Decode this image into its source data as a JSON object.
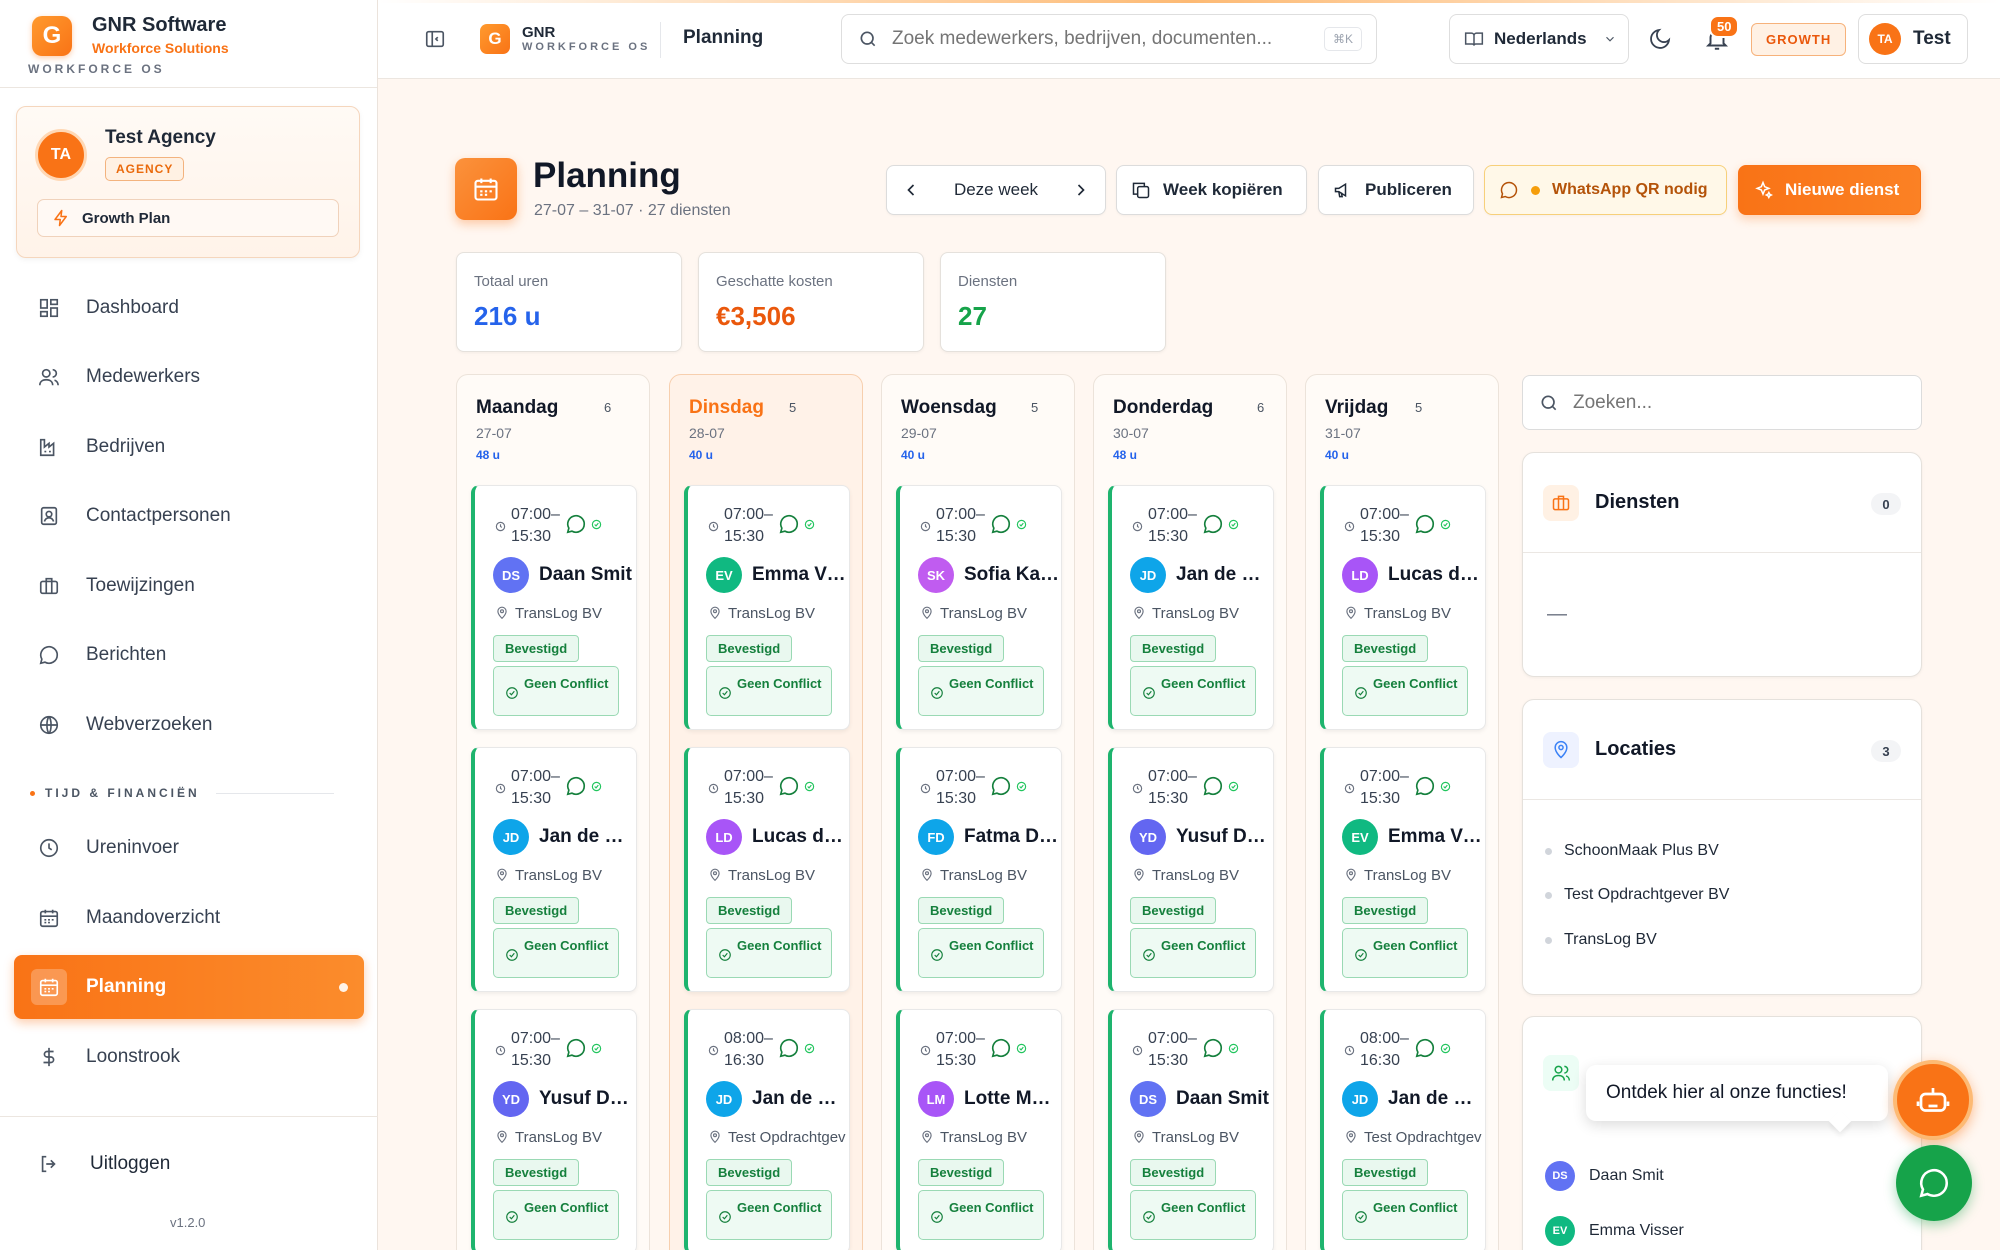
{
  "brand": {
    "name": "GNR Software",
    "subtitle": "Workforce Solutions",
    "os": "WORKFORCE OS",
    "logo_letter": "G"
  },
  "agency": {
    "initials": "TA",
    "name": "Test Agency",
    "badge": "AGENCY",
    "plan": "Growth Plan"
  },
  "nav": {
    "items": [
      {
        "label": "Dashboard",
        "icon": "dashboard-icon"
      },
      {
        "label": "Medewerkers",
        "icon": "users-icon"
      },
      {
        "label": "Bedrijven",
        "icon": "factory-icon"
      },
      {
        "label": "Contactpersonen",
        "icon": "contact-icon"
      },
      {
        "label": "Toewijzingen",
        "icon": "briefcase-icon"
      },
      {
        "label": "Berichten",
        "icon": "message-icon"
      },
      {
        "label": "Webverzoeken",
        "icon": "globe-icon"
      }
    ],
    "section_label": "TIJD & FINANCIËN",
    "section_items": [
      {
        "label": "Ureninvoer",
        "icon": "clock-icon"
      },
      {
        "label": "Maandoverzicht",
        "icon": "calendar-icon"
      },
      {
        "label": "Planning",
        "icon": "calendar-icon",
        "active": true
      },
      {
        "label": "Loonstrook",
        "icon": "dollar-icon"
      }
    ],
    "logout": "Uitloggen",
    "version": "v1.2.0"
  },
  "topbar": {
    "logo_letter": "G",
    "gnr": "GNR",
    "workforce": "WORKFORCE OS",
    "title": "Planning",
    "search_placeholder": "Zoek medewerkers, bedrijven, documenten...",
    "shortcut": "⌘K",
    "language": "Nederlands",
    "notifications": "50",
    "plan_badge": "GROWTH",
    "user_initials": "TA",
    "user_name": "Test"
  },
  "page": {
    "title": "Planning",
    "subtitle": "27-07 – 31-07 · 27 diensten",
    "week_label": "Deze week",
    "copy_label": "Week kopiëren",
    "publish_label": "Publiceren",
    "whatsapp_label": "WhatsApp QR nodig",
    "new_label": "Nieuwe dienst"
  },
  "stats": [
    {
      "label": "Totaal uren",
      "value": "216 u",
      "color": "#2563eb"
    },
    {
      "label": "Geschatte kosten",
      "value": "€3,506",
      "color": "#ea580c"
    },
    {
      "label": "Diensten",
      "value": "27",
      "color": "#16a34a"
    }
  ],
  "days": [
    {
      "name": "Maandag",
      "count": "6",
      "date": "27-07",
      "hours": "48 u",
      "today": false,
      "shifts": [
        {
          "time": "07:00–\n15:30",
          "initials": "DS",
          "name": "Daan Smit",
          "color": "#6172f3",
          "location": "TransLog BV",
          "status": "Bevestigd",
          "conflict": "Geen Conflict"
        },
        {
          "time": "07:00–\n15:30",
          "initials": "JD",
          "name": "Jan de Vries",
          "color": "#0ea5e9",
          "location": "TransLog BV",
          "status": "Bevestigd",
          "conflict": "Geen Conflict"
        },
        {
          "time": "07:00–\n15:30",
          "initials": "YD",
          "name": "Yusuf Demir",
          "color": "#6366f1",
          "location": "TransLog BV",
          "status": "Bevestigd",
          "conflict": "Geen Conflict"
        }
      ]
    },
    {
      "name": "Dinsdag",
      "count": "5",
      "date": "28-07",
      "hours": "40 u",
      "today": true,
      "shifts": [
        {
          "time": "07:00–\n15:30",
          "initials": "EV",
          "name": "Emma Visser",
          "color": "#10b981",
          "location": "TransLog BV",
          "status": "Bevestigd",
          "conflict": "Geen Conflict"
        },
        {
          "time": "07:00–\n15:30",
          "initials": "LD",
          "name": "Lucas de Boer",
          "color": "#a855f7",
          "location": "TransLog BV",
          "status": "Bevestigd",
          "conflict": "Geen Conflict"
        },
        {
          "time": "08:00–\n16:30",
          "initials": "JD",
          "name": "Jan de Vries",
          "color": "#0ea5e9",
          "location": "Test Opdrachtgever BV",
          "status": "Bevestigd",
          "conflict": "Geen Conflict"
        }
      ]
    },
    {
      "name": "Woensdag",
      "count": "5",
      "date": "29-07",
      "hours": "40 u",
      "today": false,
      "shifts": [
        {
          "time": "07:00–\n15:30",
          "initials": "SK",
          "name": "Sofia Kaya",
          "color": "#c05cf0",
          "location": "TransLog BV",
          "status": "Bevestigd",
          "conflict": "Geen Conflict"
        },
        {
          "time": "07:00–\n15:30",
          "initials": "FD",
          "name": "Fatma Demir",
          "color": "#0ea5e9",
          "location": "TransLog BV",
          "status": "Bevestigd",
          "conflict": "Geen Conflict"
        },
        {
          "time": "07:00–\n15:30",
          "initials": "LM",
          "name": "Lotte Mulder",
          "color": "#a855f7",
          "location": "TransLog BV",
          "status": "Bevestigd",
          "conflict": "Geen Conflict"
        }
      ]
    },
    {
      "name": "Donderdag",
      "count": "6",
      "date": "30-07",
      "hours": "48 u",
      "today": false,
      "shifts": [
        {
          "time": "07:00–\n15:30",
          "initials": "JD",
          "name": "Jan de Vries",
          "color": "#0ea5e9",
          "location": "TransLog BV",
          "status": "Bevestigd",
          "conflict": "Geen Conflict"
        },
        {
          "time": "07:00–\n15:30",
          "initials": "YD",
          "name": "Yusuf Demir",
          "color": "#6366f1",
          "location": "TransLog BV",
          "status": "Bevestigd",
          "conflict": "Geen Conflict"
        },
        {
          "time": "07:00–\n15:30",
          "initials": "DS",
          "name": "Daan Smit",
          "color": "#6172f3",
          "location": "TransLog BV",
          "status": "Bevestigd",
          "conflict": "Geen Conflict"
        }
      ]
    },
    {
      "name": "Vrijdag",
      "count": "5",
      "date": "31-07",
      "hours": "40 u",
      "today": false,
      "shifts": [
        {
          "time": "07:00–\n15:30",
          "initials": "LD",
          "name": "Lucas de Boer",
          "color": "#a855f7",
          "location": "TransLog BV",
          "status": "Bevestigd",
          "conflict": "Geen Conflict"
        },
        {
          "time": "07:00–\n15:30",
          "initials": "EV",
          "name": "Emma Visser",
          "color": "#10b981",
          "location": "TransLog BV",
          "status": "Bevestigd",
          "conflict": "Geen Conflict"
        },
        {
          "time": "08:00–\n16:30",
          "initials": "JD",
          "name": "Jan de Vries",
          "color": "#0ea5e9",
          "location": "Test Opdrachtgever BV",
          "status": "Bevestigd",
          "conflict": "Geen Conflict"
        }
      ]
    }
  ],
  "right_panel": {
    "search_placeholder": "Zoeken...",
    "diensten": {
      "title": "Diensten",
      "count": "0",
      "empty": "—"
    },
    "locaties": {
      "title": "Locaties",
      "count": "3",
      "items": [
        "SchoonMaak Plus BV",
        "Test Opdrachtgever BV",
        "TransLog BV"
      ]
    },
    "employees": [
      {
        "initials": "DS",
        "name": "Daan Smit",
        "color": "#6172f3"
      },
      {
        "initials": "EV",
        "name": "Emma Visser",
        "color": "#10b981"
      }
    ],
    "tooltip": "Ontdek hier al onze functies!"
  }
}
